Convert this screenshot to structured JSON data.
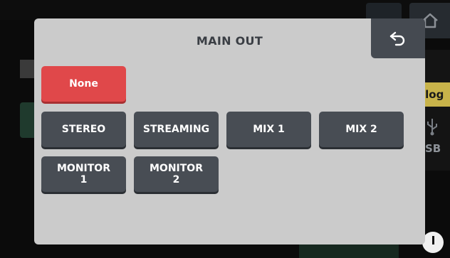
{
  "background": {
    "side_label_1": "alog",
    "side_label_2": "SB"
  },
  "dialog": {
    "title": "MAIN OUT",
    "buttons": [
      {
        "label": "None",
        "selected": true
      },
      {
        "label": "STEREO",
        "selected": false
      },
      {
        "label": "STREAMING",
        "selected": false
      },
      {
        "label": "MIX 1",
        "selected": false
      },
      {
        "label": "MIX 2",
        "selected": false
      },
      {
        "label": "MONITOR\n1",
        "selected": false
      },
      {
        "label": "MONITOR\n2",
        "selected": false
      }
    ]
  },
  "colors": {
    "selected": "#e0484a",
    "button": "#484d54",
    "dialog": "#cbcbcb",
    "analog_tab": "#c8b34a"
  },
  "icons": [
    "return-arrow-icon",
    "home-icon",
    "usb-icon",
    "knob-icon"
  ]
}
